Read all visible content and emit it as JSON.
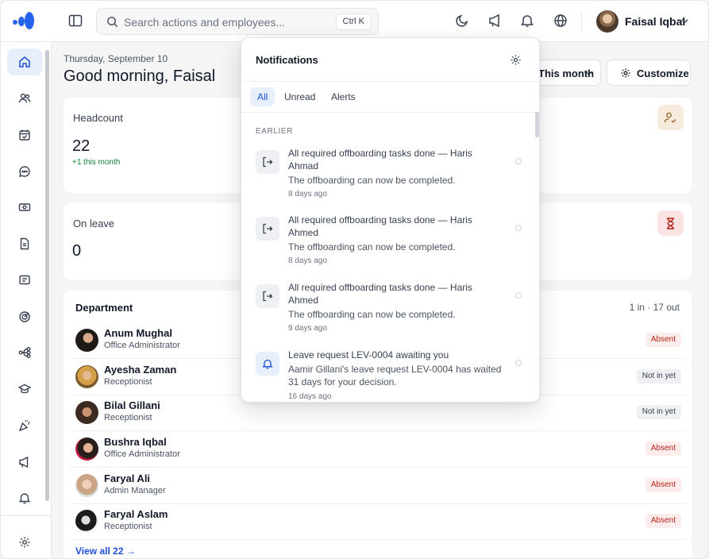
{
  "topbar": {
    "search_placeholder": "Search actions and employees...",
    "search_shortcut": "Ctrl K",
    "user_name": "Faisal Iqbal"
  },
  "sidebar": {
    "items": [
      "home-icon",
      "users-icon",
      "calendar-check-icon",
      "chat-icon",
      "money-icon",
      "document-icon",
      "message-square-icon",
      "target-icon",
      "workflow-icon",
      "graduation-cap-icon",
      "party-popper-icon",
      "megaphone-icon",
      "bell-icon"
    ],
    "bottom": "settings-icon"
  },
  "greeting": {
    "date": "Thursday, September 10",
    "title": "Good morning, Faisal"
  },
  "toolbar": {
    "period_label": "This month",
    "customize_label": "Customize"
  },
  "cards": {
    "headcount": {
      "title": "Headcount",
      "value": "22",
      "sub": "+1 this month"
    },
    "on_leave": {
      "title": "On leave",
      "value": "0"
    }
  },
  "department": {
    "title": "Department",
    "count": "1 in · 17 out",
    "view_all": "View all 22 →",
    "employees": [
      {
        "name": "Anum Mughal",
        "role": "Office Administrator",
        "status": "Absent"
      },
      {
        "name": "Ayesha Zaman",
        "role": "Receptionist",
        "status": "Not in yet"
      },
      {
        "name": "Bilal Gillani",
        "role": "Receptionist",
        "status": "Not in yet"
      },
      {
        "name": "Bushra Iqbal",
        "role": "Office Administrator",
        "status": "Absent"
      },
      {
        "name": "Faryal Ali",
        "role": "Admin Manager",
        "status": "Absent"
      },
      {
        "name": "Faryal Aslam",
        "role": "Receptionist",
        "status": "Absent"
      }
    ]
  },
  "notifications": {
    "title": "Notifications",
    "tabs": [
      "All",
      "Unread",
      "Alerts"
    ],
    "active_tab": "All",
    "section": "EARLIER",
    "items": [
      {
        "icon": "sign-out-icon",
        "title": "All required offboarding tasks done — Haris Ahmad",
        "body": "The offboarding can now be completed.",
        "time": "8 days ago"
      },
      {
        "icon": "sign-out-icon",
        "title": "All required offboarding tasks done — Haris Ahmed",
        "body": "The offboarding can now be completed.",
        "time": "8 days ago"
      },
      {
        "icon": "sign-out-icon",
        "title": "All required offboarding tasks done — Haris Ahmed",
        "body": "The offboarding can now be completed.",
        "time": "9 days ago"
      },
      {
        "icon": "bell-icon",
        "title": "Leave request LEV-0004 awaiting you",
        "body": "Aamir Gillani's leave request LEV-0004 has waited 31 days for your decision.",
        "time": "16 days ago"
      }
    ]
  },
  "colors": {
    "accent": "#1d4ed8",
    "logo": "#2563eb",
    "absent_bg": "#fdecec",
    "absent_text": "#b42318",
    "positive": "#15803d"
  }
}
